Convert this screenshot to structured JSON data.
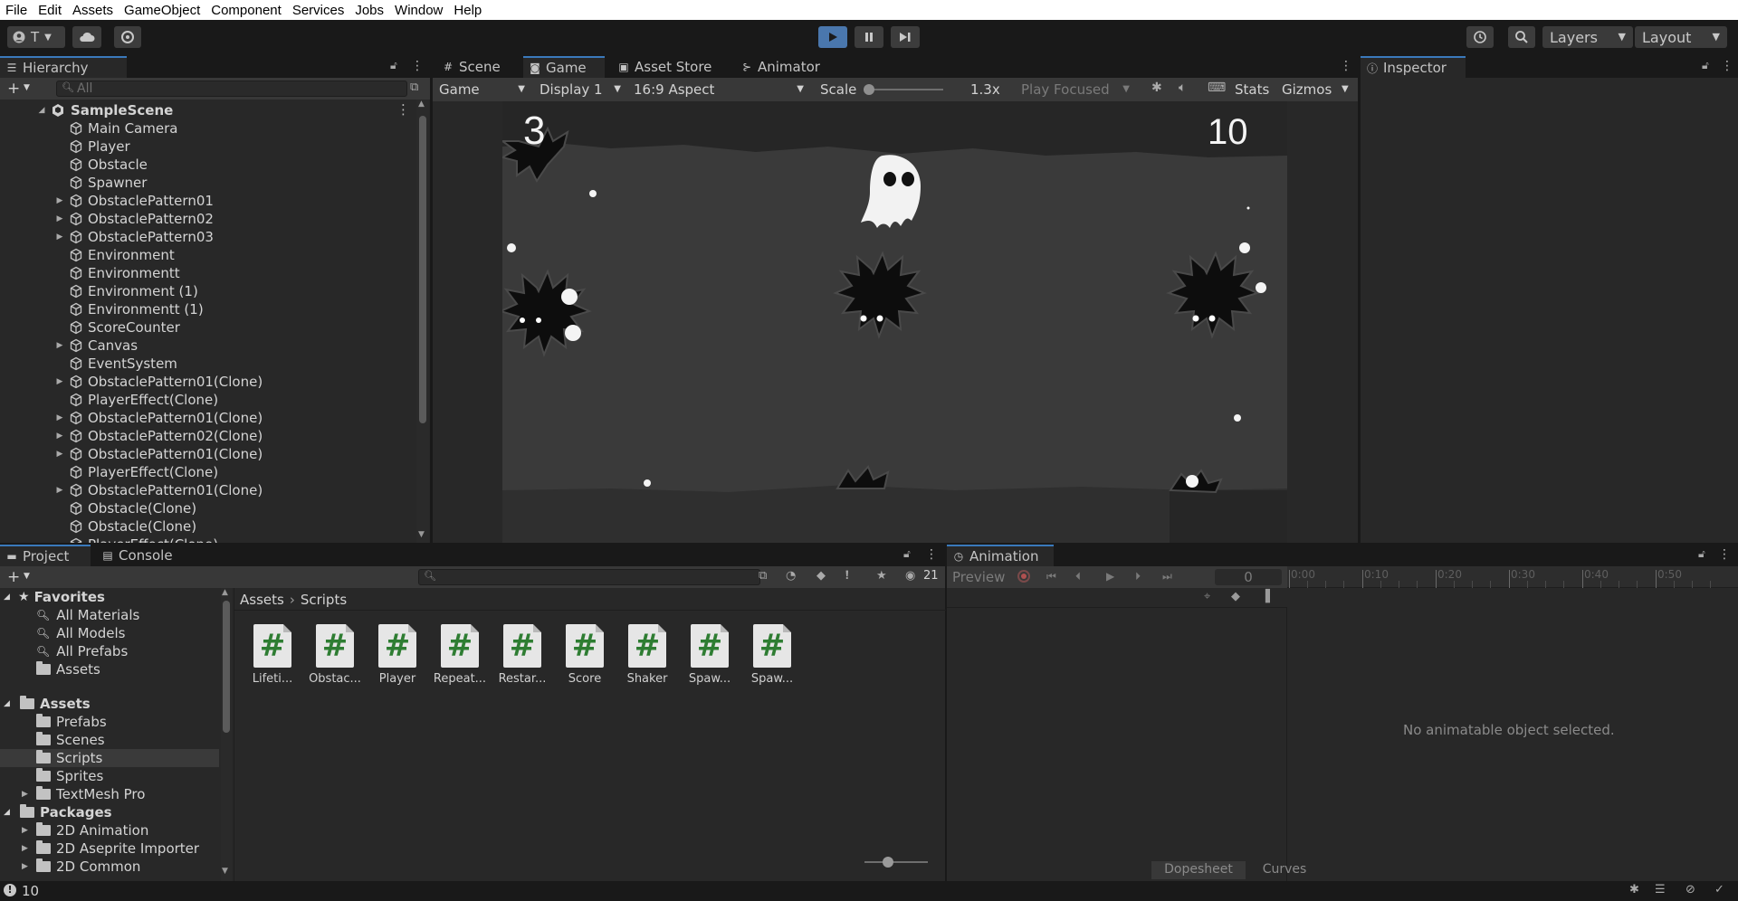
{
  "menu": [
    "File",
    "Edit",
    "Assets",
    "GameObject",
    "Component",
    "Services",
    "Jobs",
    "Window",
    "Help"
  ],
  "toolbar": {
    "account_label": "T",
    "layers_label": "Layers",
    "layout_label": "Layout"
  },
  "hierarchy": {
    "tab_label": "Hierarchy",
    "search_placeholder": "All",
    "scene_name": "SampleScene",
    "items": [
      {
        "label": "Main Camera",
        "expandable": false
      },
      {
        "label": "Player",
        "expandable": false
      },
      {
        "label": "Obstacle",
        "expandable": false
      },
      {
        "label": "Spawner",
        "expandable": false
      },
      {
        "label": "ObstaclePattern01",
        "expandable": true
      },
      {
        "label": "ObstaclePattern02",
        "expandable": true
      },
      {
        "label": "ObstaclePattern03",
        "expandable": true
      },
      {
        "label": "Environment",
        "expandable": false
      },
      {
        "label": "Environmentt",
        "expandable": false
      },
      {
        "label": "Environment (1)",
        "expandable": false
      },
      {
        "label": "Environmentt (1)",
        "expandable": false
      },
      {
        "label": "ScoreCounter",
        "expandable": false
      },
      {
        "label": "Canvas",
        "expandable": true
      },
      {
        "label": "EventSystem",
        "expandable": false
      },
      {
        "label": "ObstaclePattern01(Clone)",
        "expandable": true
      },
      {
        "label": "PlayerEffect(Clone)",
        "expandable": false
      },
      {
        "label": "ObstaclePattern01(Clone)",
        "expandable": true
      },
      {
        "label": "ObstaclePattern02(Clone)",
        "expandable": true
      },
      {
        "label": "ObstaclePattern01(Clone)",
        "expandable": true
      },
      {
        "label": "PlayerEffect(Clone)",
        "expandable": false
      },
      {
        "label": "ObstaclePattern01(Clone)",
        "expandable": true
      },
      {
        "label": "Obstacle(Clone)",
        "expandable": false
      },
      {
        "label": "Obstacle(Clone)",
        "expandable": false
      },
      {
        "label": "PlayerEffect(Clone)",
        "expandable": false
      }
    ]
  },
  "center_tabs": {
    "scene": "Scene",
    "game": "Game",
    "asset_store": "Asset Store",
    "animator": "Animator"
  },
  "game_bar": {
    "mode": "Game",
    "display": "Display 1",
    "aspect": "16:9 Aspect",
    "scale_label": "Scale",
    "scale_value": "1.3x",
    "play_focused": "Play Focused",
    "stats": "Stats",
    "gizmos": "Gizmos"
  },
  "game_view": {
    "score_left": "3",
    "score_right": "10"
  },
  "inspector": {
    "tab_label": "Inspector"
  },
  "project": {
    "tab_project": "Project",
    "tab_console": "Console",
    "hidden_count": "21",
    "breadcrumb_root": "Assets",
    "breadcrumb_current": "Scripts",
    "favorites_label": "Favorites",
    "favorites": [
      "All Materials",
      "All Models",
      "All Prefabs",
      "Assets"
    ],
    "assets_label": "Assets",
    "asset_folders": [
      "Prefabs",
      "Scenes",
      "Scripts",
      "Sprites",
      "TextMesh Pro"
    ],
    "packages_label": "Packages",
    "packages": [
      "2D Animation",
      "2D Aseprite Importer",
      "2D Common"
    ],
    "scripts": [
      "Lifeti...",
      "Obstac...",
      "Player",
      "Repeat...",
      "Restar...",
      "Score",
      "Shaker",
      "Spaw...",
      "Spaw..."
    ]
  },
  "animation": {
    "tab_label": "Animation",
    "preview_label": "Preview",
    "frame_value": "0",
    "timeline_ticks": [
      "0:00",
      "0:10",
      "0:20",
      "0:30",
      "0:40",
      "0:50"
    ],
    "empty_message": "No animatable object selected.",
    "dopesheet_label": "Dopesheet",
    "curves_label": "Curves"
  },
  "status": {
    "console_count": "10"
  },
  "colors": {
    "accent_blue": "#3a79bb",
    "play_active": "#4a77ad"
  }
}
